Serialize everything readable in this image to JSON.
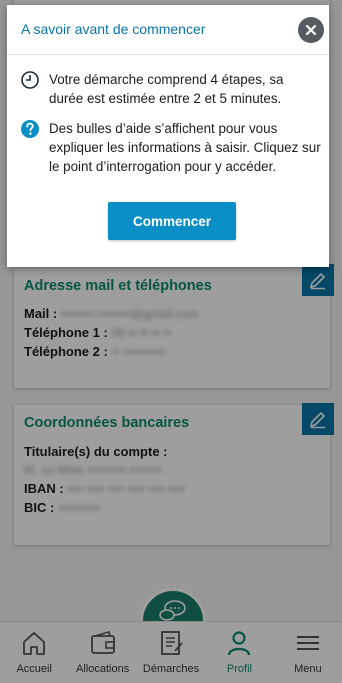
{
  "modal": {
    "title": "A savoir avant de commencer",
    "info_steps": "Votre démarche comprend 4 étapes, sa durée est estimée entre 2 et 5 minutes.",
    "info_help": "Des bulles d’aide s’affichent pour vous expliquer les informations à saisir. Cliquez sur le point d’interrogation pour y accéder.",
    "start_label": "Commencer"
  },
  "contact_card": {
    "title": "Adresse mail et téléphones",
    "mail_label": "Mail :",
    "mail_value": "••••••••.••••••••@gmail.com",
    "phone1_label": "Téléphone 1 :",
    "phone1_value": "06 •• •• •• ••",
    "phone2_label": "Téléphone 2 :",
    "phone2_value": "•• ••••••••••"
  },
  "bank_card": {
    "title": "Coordonnées bancaires",
    "holder_label": "Titulaire(s) du compte :",
    "holder_value": "M. ou Mme ••••••••• ••••••••",
    "iban_label": "IBAN :",
    "iban_value": "•••• •••• •••• •••• •••• ••••",
    "bic_label": "BIC :",
    "bic_value": "••••••••••"
  },
  "nav": [
    {
      "label": "Accueil",
      "icon": "home-icon"
    },
    {
      "label": "Allocations",
      "icon": "wallet-icon"
    },
    {
      "label": "Démarches",
      "icon": "document-icon"
    },
    {
      "label": "Profil",
      "icon": "person-icon"
    },
    {
      "label": "Menu",
      "icon": "menu-icon"
    }
  ],
  "colors": {
    "accent_blue": "#0a8ec6",
    "title_green": "#0b8a6e",
    "edit_blue": "#0a74a8"
  }
}
